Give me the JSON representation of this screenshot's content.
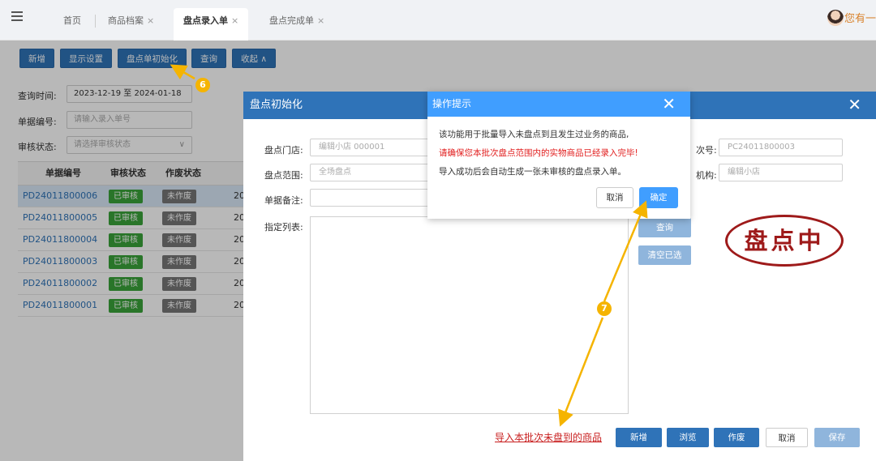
{
  "topbar": {
    "tabs": [
      {
        "label": "首页"
      },
      {
        "label": "商品档案",
        "close": "×"
      },
      {
        "label": "盘点录入单",
        "close": "×"
      },
      {
        "label": "盘点完成单",
        "close": "×"
      }
    ],
    "user": "您有一"
  },
  "toolbar": {
    "buttons": [
      "新增",
      "显示设置",
      "盘点单初始化",
      "查询",
      "收起 ∧"
    ]
  },
  "filters": {
    "query_time_label": "查询时间:",
    "query_time_value": "2023-12-19 至 2024-01-18",
    "doc_no_label": "单据编号:",
    "doc_no_placeholder": "请输入录入单号",
    "audit_label": "审核状态:",
    "audit_placeholder": "请选择审核状态",
    "audit_caret": "∨"
  },
  "table": {
    "headers": [
      "单据编号",
      "审核状态",
      "作废状态"
    ],
    "rows": [
      {
        "code": "PD24011800006",
        "audit": "已审核",
        "void": "未作废",
        "date": "20"
      },
      {
        "code": "PD24011800005",
        "audit": "已审核",
        "void": "未作废",
        "date": "20"
      },
      {
        "code": "PD24011800004",
        "audit": "已审核",
        "void": "未作废",
        "date": "20"
      },
      {
        "code": "PD24011800003",
        "audit": "已审核",
        "void": "未作废",
        "date": "20"
      },
      {
        "code": "PD24011800002",
        "audit": "已审核",
        "void": "未作废",
        "date": "20"
      },
      {
        "code": "PD24011800001",
        "audit": "已审核",
        "void": "未作废",
        "date": "20"
      }
    ]
  },
  "init_dialog": {
    "title": "盘点初始化",
    "close": "✕",
    "store_label": "盘点门店:",
    "store_value": "编辑小店 000001",
    "range_label": "盘点范围:",
    "range_value": "全场盘点",
    "remark_label": "单据备注:",
    "list_label": "指定列表:",
    "batch_label": "次号:",
    "batch_value": "PC24011800003",
    "org_label": "机构:",
    "org_value": "编辑小店",
    "query_button": "查询",
    "clear_button": "清空已选",
    "stamp": "盘点中",
    "import_link": "导入本批次未盘到的商品",
    "footer_buttons": [
      "新增",
      "浏览",
      "作废",
      "取消",
      "保存"
    ]
  },
  "confirm_dialog": {
    "title": "操作提示",
    "close": "✕",
    "line1": "该功能用于批量导入未盘点到且发生过业务的商品,",
    "line2": "请确保您本批次盘点范围内的实物商品已经录入完毕!",
    "line3": "导入成功后会自动生成一张未审核的盘点录入单。",
    "cancel": "取消",
    "ok": "确定"
  },
  "annotations": {
    "step6": "6",
    "step7": "7"
  },
  "colors": {
    "primary": "#2f73b8",
    "dialog_header": "#409eff",
    "success": "#39a339",
    "danger": "#e11d1d",
    "marker": "#f5b400"
  }
}
